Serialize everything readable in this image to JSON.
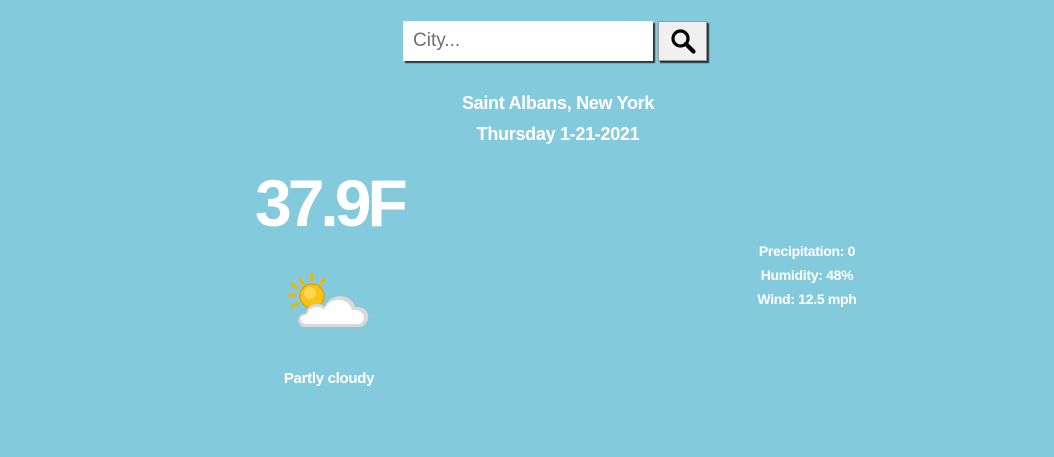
{
  "search": {
    "placeholder": "City...",
    "value": "",
    "button_icon": "search-icon"
  },
  "location": "Saint Albans, New York",
  "date": "Thursday 1-21-2021",
  "current": {
    "temperature": "37.9F",
    "condition": "Partly cloudy",
    "icon": "partly-cloudy-icon"
  },
  "details": {
    "precipitation": "Precipitation: 0",
    "humidity": "Humidity: 48%",
    "wind": "Wind: 12.5 mph"
  },
  "colors": {
    "background": "#84cadd",
    "text": "#ffffff",
    "sun": "#f7c21a",
    "cloud": "#f2f2f2"
  }
}
